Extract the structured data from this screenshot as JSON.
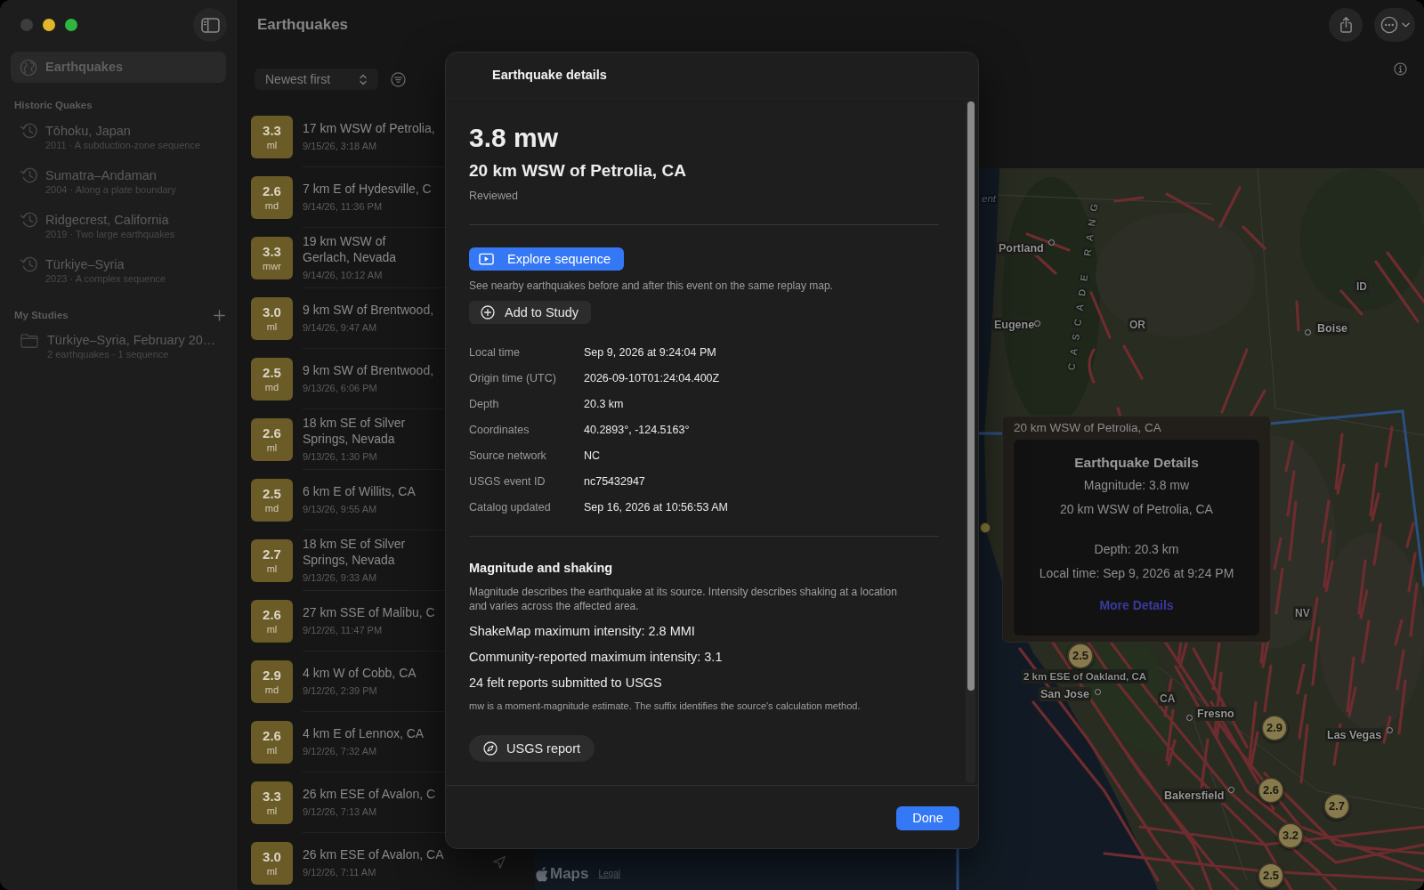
{
  "window": {
    "title": "Earthquakes",
    "controls": [
      {
        "kind": "close",
        "disabled": true
      },
      {
        "kind": "minimize",
        "disabled": false
      },
      {
        "kind": "zoom",
        "disabled": false
      }
    ]
  },
  "sidebar": {
    "items": [
      {
        "label": "Earthquakes",
        "selected": true
      }
    ],
    "sections": [
      {
        "title": "Historic Quakes",
        "kind": "history",
        "items": [
          {
            "title": "Tōhoku, Japan",
            "subtitle": "2011 · A subduction-zone sequence",
            "selected": false
          },
          {
            "title": "Sumatra–Andaman",
            "subtitle": "2004 · Along a plate boundary",
            "selected": false
          },
          {
            "title": "Ridgecrest, California",
            "subtitle": "2019 · Two large earthquakes",
            "selected": false
          },
          {
            "title": "Türkiye–Syria",
            "subtitle": "2023 · A complex sequence",
            "selected": false
          }
        ]
      },
      {
        "title": "My Studies",
        "kind": "studies",
        "items": [
          {
            "title": "Türkiye–Syria, February 20…",
            "subtitle": "2 earthquakes · 1 sequence",
            "selected": false
          }
        ]
      }
    ]
  },
  "list": {
    "sort": "Newest first",
    "quakes": [
      {
        "magnitude": "3.3",
        "type": "ml",
        "place": "17 km WSW of Petrolia,",
        "time": "9/15/26, 3:18 AM",
        "selected": false
      },
      {
        "magnitude": "2.6",
        "type": "md",
        "place": "7 km E of Hydesville, C",
        "time": "9/14/26, 11:36 PM",
        "selected": false
      },
      {
        "magnitude": "3.3",
        "type": "mwr",
        "place": "19 km WSW of Gerlach, Nevada",
        "time": "9/14/26, 10:12 AM",
        "selected": false
      },
      {
        "magnitude": "3.0",
        "type": "ml",
        "place": "9 km SW of Brentwood,",
        "time": "9/14/26, 9:47 AM",
        "selected": false
      },
      {
        "magnitude": "2.5",
        "type": "md",
        "place": "9 km SW of Brentwood,",
        "time": "9/13/26, 6:06 PM",
        "selected": false
      },
      {
        "magnitude": "2.6",
        "type": "ml",
        "place": "18 km SE of Silver Springs, Nevada",
        "time": "9/13/26, 1:30 PM",
        "selected": false
      },
      {
        "magnitude": "2.5",
        "type": "md",
        "place": "6 km E of Willits, CA",
        "time": "9/13/26, 9:55 AM",
        "selected": false
      },
      {
        "magnitude": "2.7",
        "type": "ml",
        "place": "18 km SE of Silver Springs, Nevada",
        "time": "9/13/26, 9:33 AM",
        "selected": false
      },
      {
        "magnitude": "2.6",
        "type": "ml",
        "place": "27 km SSE of Malibu, C",
        "time": "9/12/26, 11:47 PM",
        "selected": false
      },
      {
        "magnitude": "2.9",
        "type": "md",
        "place": "4 km W of Cobb, CA",
        "time": "9/12/26, 2:39 PM",
        "selected": false
      },
      {
        "magnitude": "2.6",
        "type": "ml",
        "place": "4 km E of Lennox, CA",
        "time": "9/12/26, 7:32 AM",
        "selected": false
      },
      {
        "magnitude": "3.3",
        "type": "ml",
        "place": "26 km ESE of Avalon, C",
        "time": "9/12/26, 7:13 AM",
        "selected": false
      },
      {
        "magnitude": "3.0",
        "type": "ml",
        "place": "26 km ESE of Avalon, CA",
        "time": "9/12/26, 7:11 AM",
        "selected": false
      }
    ]
  },
  "details": {
    "title": "Earthquake details",
    "magnitude": "3.8 mw",
    "place": "20 km WSW of Petrolia, CA",
    "status": "Reviewed",
    "primary_action": "Explore sequence",
    "primary_note": "See nearby earthquakes before and after this event on the same replay map.",
    "secondary_action": "Add to Study",
    "facts": [
      {
        "label": "Local time",
        "value": "Sep 9, 2026 at 9:24:04 PM"
      },
      {
        "label": "Origin time (UTC)",
        "value": "2026-09-10T01:24:04.400Z"
      },
      {
        "label": "Depth",
        "value": "20.3 km"
      },
      {
        "label": "Coordinates",
        "value": "40.2893°, -124.5163°"
      },
      {
        "label": "Source network",
        "value": "NC"
      },
      {
        "label": "USGS event ID",
        "value": "nc75432947"
      },
      {
        "label": "Catalog updated",
        "value": "Sep 16, 2026 at 10:56:53 AM"
      }
    ],
    "section_title": "Magnitude and shaking",
    "section_note": "Magnitude describes the earthquake at its source. Intensity describes shaking at a location and varies across the affected area.",
    "metrics": [
      "ShakeMap maximum intensity: 2.8 MMI",
      "Community-reported maximum intensity: 3.1",
      "24 felt reports submitted to USGS"
    ],
    "footnote": "mw is a moment-magnitude estimate. The suffix identifies the source's calculation method.",
    "report_link": "USGS report",
    "done": "Done"
  },
  "map": {
    "labels": [
      {
        "text": "ent",
        "kind": "water"
      },
      {
        "text": "Portland",
        "kind": "city"
      },
      {
        "text": "Eugene",
        "kind": "city"
      },
      {
        "text": "OR",
        "kind": "state"
      },
      {
        "text": "Boise",
        "kind": "city"
      },
      {
        "text": "ID",
        "kind": "state"
      },
      {
        "text": "CASCADE RANG",
        "kind": "range"
      },
      {
        "text": "NV",
        "kind": "state"
      },
      {
        "text": "2 km ESE of Oakland, CA",
        "kind": "quake"
      },
      {
        "text": "San Jose",
        "kind": "city"
      },
      {
        "text": "CA",
        "kind": "state"
      },
      {
        "text": "Fresno",
        "kind": "city"
      },
      {
        "text": "Las Vegas",
        "kind": "city"
      },
      {
        "text": "Bakersfield",
        "kind": "city"
      }
    ],
    "markers": [
      {
        "label": "2.5"
      },
      {
        "label": "2.9"
      },
      {
        "label": "2.6"
      },
      {
        "label": "2.7"
      },
      {
        "label": "3.2"
      },
      {
        "label": "2.5"
      }
    ],
    "callout": {
      "title": "20 km WSW of Petrolia, CA",
      "heading": "Earthquake Details",
      "groups": [
        {
          "lines": [
            "Magnitude: 3.8 mw",
            "20 km WSW of Petrolia, CA"
          ]
        },
        {
          "lines": [
            "Depth: 20.3 km",
            "Local time: Sep 9, 2026 at 9:24 PM"
          ]
        }
      ],
      "link": "More Details"
    },
    "attribution": {
      "brand": "Maps",
      "legal": "Legal"
    }
  }
}
